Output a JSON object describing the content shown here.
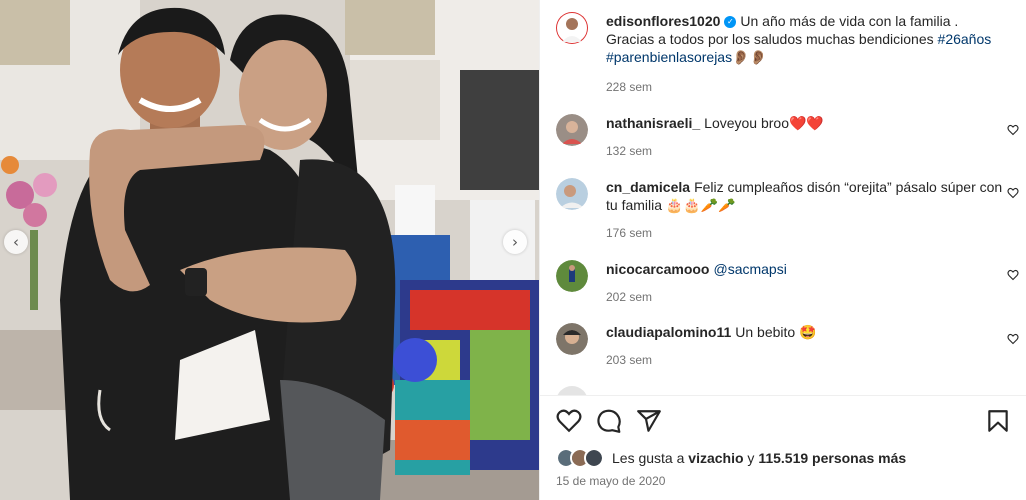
{
  "colors": {
    "accent": "#0095f6",
    "heart": "#ed4956",
    "link": "#00376b",
    "muted": "#737373"
  },
  "photo": {
    "prev_icon": "chevron-left-icon",
    "next_icon": "chevron-right-icon",
    "prev_glyph": "‹",
    "next_glyph": "›"
  },
  "caption": {
    "username": "edisonflores1020",
    "verified_glyph": "✓",
    "text": "Un año más de vida con la familia . Gracias a todos por los saludos muchas bendiciones",
    "hashtag1": "#26años",
    "hashtag2": "#parenbienlasorejas",
    "emoji": "👂🏽👂🏽",
    "time": "228 sem"
  },
  "comments": [
    {
      "username": "nathanisraeli_",
      "text": "Loveyou broo",
      "emoji": "❤️❤️",
      "time": "132 sem"
    },
    {
      "username": "cn_damicela",
      "text": "Feliz cumpleaños disón “orejita” pásalo súper con tu familia",
      "emoji": "🎂🎂🥕🥕",
      "time": "176 sem"
    },
    {
      "username": "nicocarcamooo",
      "mention": "@sacmapsi",
      "time": "202 sem"
    },
    {
      "username": "claudiapalomino11",
      "text": "Un bebito",
      "emoji": "🤩",
      "time": "203 sem"
    }
  ],
  "actions": {
    "like_icon": "heart-icon",
    "comment_icon": "comment-icon",
    "share_icon": "share-icon",
    "save_icon": "bookmark-icon"
  },
  "likes": {
    "prefix": "Les gusta a",
    "user": "vizachio",
    "mid": "y",
    "count": "115.519 personas más"
  },
  "date": "15 de mayo de 2020"
}
